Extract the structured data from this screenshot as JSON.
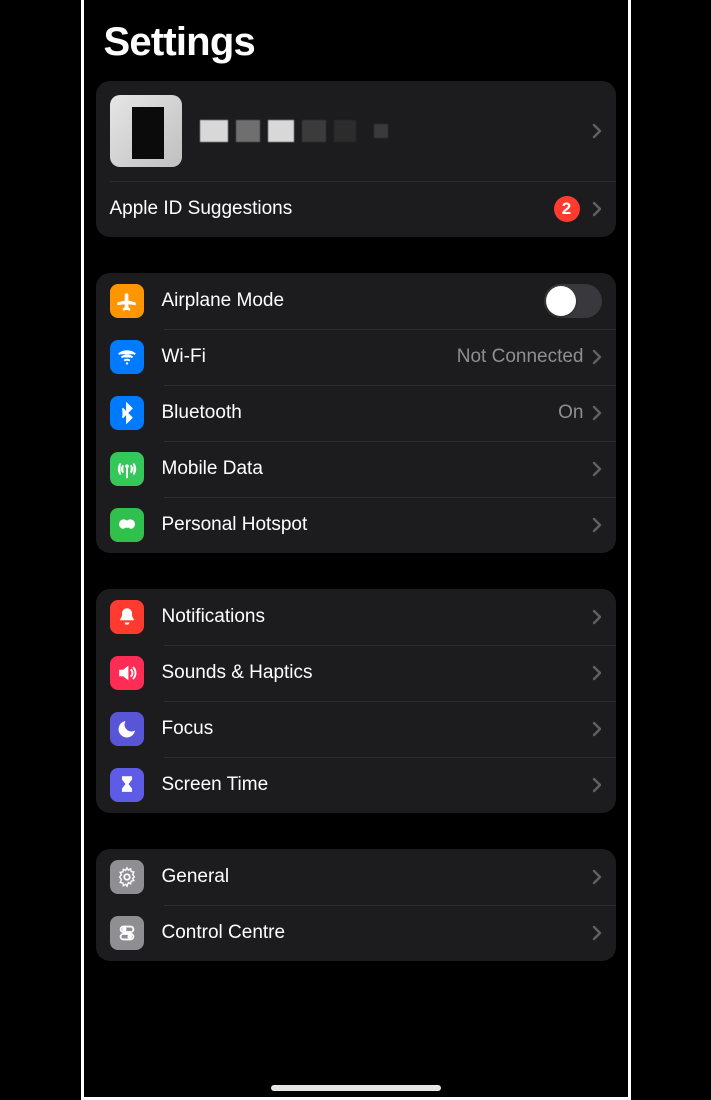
{
  "title": "Settings",
  "profile": {
    "suggestions_label": "Apple ID Suggestions",
    "suggestions_badge": "2"
  },
  "group_network": {
    "airplane": "Airplane Mode",
    "wifi": "Wi-Fi",
    "wifi_value": "Not Connected",
    "bluetooth": "Bluetooth",
    "bluetooth_value": "On",
    "mobile_data": "Mobile Data",
    "personal_hotspot": "Personal Hotspot"
  },
  "group_alerts": {
    "notifications": "Notifications",
    "sounds": "Sounds & Haptics",
    "focus": "Focus",
    "screen_time": "Screen Time"
  },
  "group_general": {
    "general": "General",
    "control_centre": "Control Centre"
  },
  "airplane_toggle_on": false
}
